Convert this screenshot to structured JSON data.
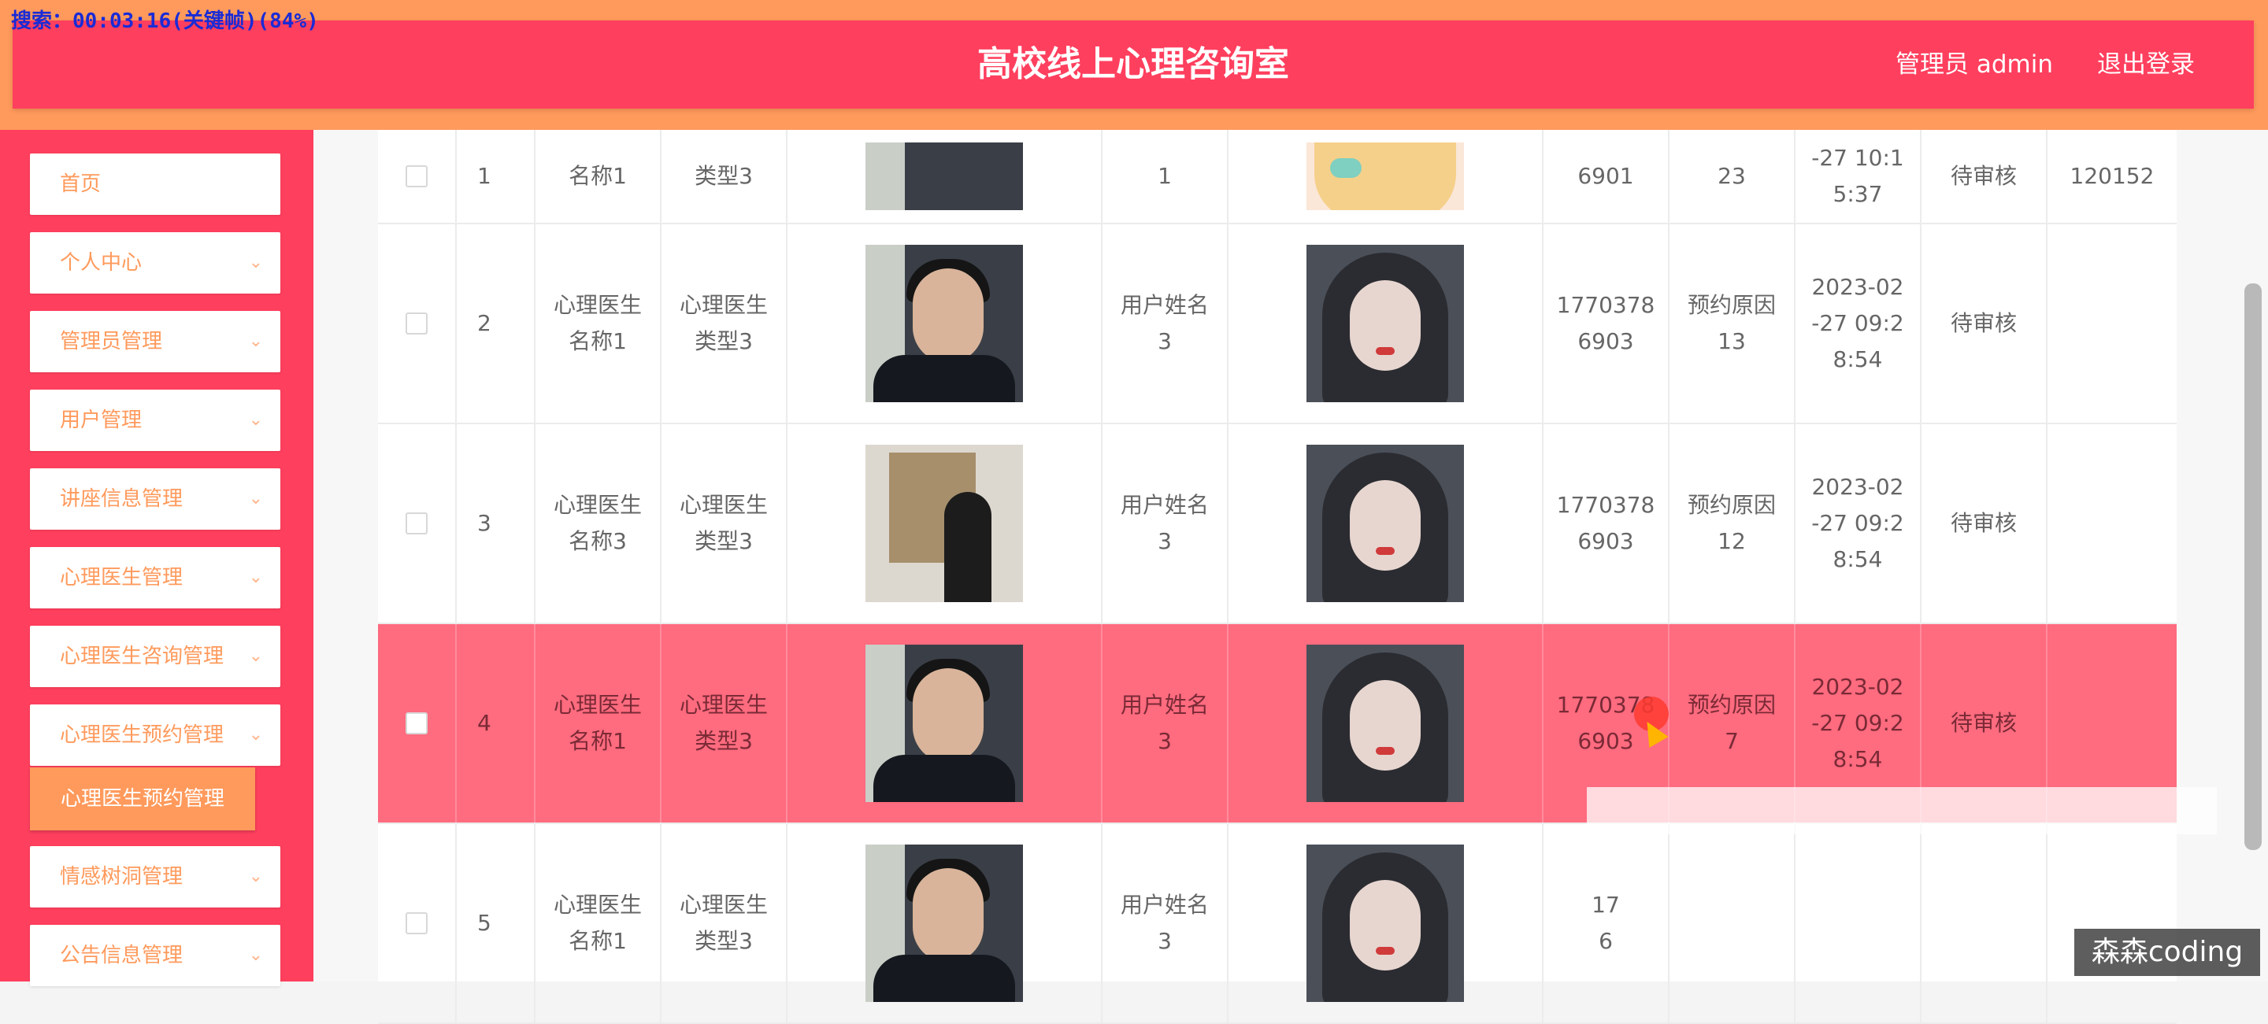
{
  "overlay": {
    "search_status": "搜索：00:03:16(关键帧)(84%)"
  },
  "header": {
    "title": "高校线上心理咨询室",
    "user": "管理员 admin",
    "logout": "退出登录"
  },
  "sidebar": {
    "items": [
      {
        "label": "首页"
      },
      {
        "label": "个人中心"
      },
      {
        "label": "管理员管理"
      },
      {
        "label": "用户管理"
      },
      {
        "label": "讲座信息管理"
      },
      {
        "label": "心理医生管理"
      },
      {
        "label": "心理医生咨询管理"
      },
      {
        "label": "心理医生预约管理"
      },
      {
        "label": "情感树洞管理"
      },
      {
        "label": "公告信息管理"
      }
    ],
    "sub_active": "心理医生预约管理"
  },
  "table": {
    "rows": [
      {
        "num": "1",
        "doctor_name": "名称1",
        "doctor_type": "类型3",
        "user_name": "1",
        "phone": "6901",
        "reason": "23",
        "time": "-27 10:1\n5:37",
        "status": "待审核",
        "extra": "120152"
      },
      {
        "num": "2",
        "doctor_name": "心理医生\n名称1",
        "doctor_type": "心理医生\n类型3",
        "user_name": "用户姓名\n3",
        "phone": "1770378\n6903",
        "reason": "预约原因\n13",
        "time": "2023-02\n-27 09:2\n8:54",
        "status": "待审核",
        "extra": ""
      },
      {
        "num": "3",
        "doctor_name": "心理医生\n名称3",
        "doctor_type": "心理医生\n类型3",
        "user_name": "用户姓名\n3",
        "phone": "1770378\n6903",
        "reason": "预约原因\n12",
        "time": "2023-02\n-27 09:2\n8:54",
        "status": "待审核",
        "extra": ""
      },
      {
        "num": "4",
        "doctor_name": "心理医生\n名称1",
        "doctor_type": "心理医生\n类型3",
        "user_name": "用户姓名\n3",
        "phone": "1770378\n6903",
        "reason": "预约原因\n7",
        "time": "2023-02\n-27 09:2\n8:54",
        "status": "待审核",
        "extra": ""
      },
      {
        "num": "5",
        "doctor_name": "心理医生\n名称1",
        "doctor_type": "心理医生\n类型3",
        "user_name": "用户姓名\n3",
        "phone": "17\n6",
        "reason": "",
        "time": "",
        "status": "",
        "extra": ""
      }
    ]
  },
  "watermark": "森森coding",
  "colors": {
    "primary": "#ff3f5e",
    "accent": "#ff9a5c",
    "highlight_row": "#ff6b7f"
  }
}
